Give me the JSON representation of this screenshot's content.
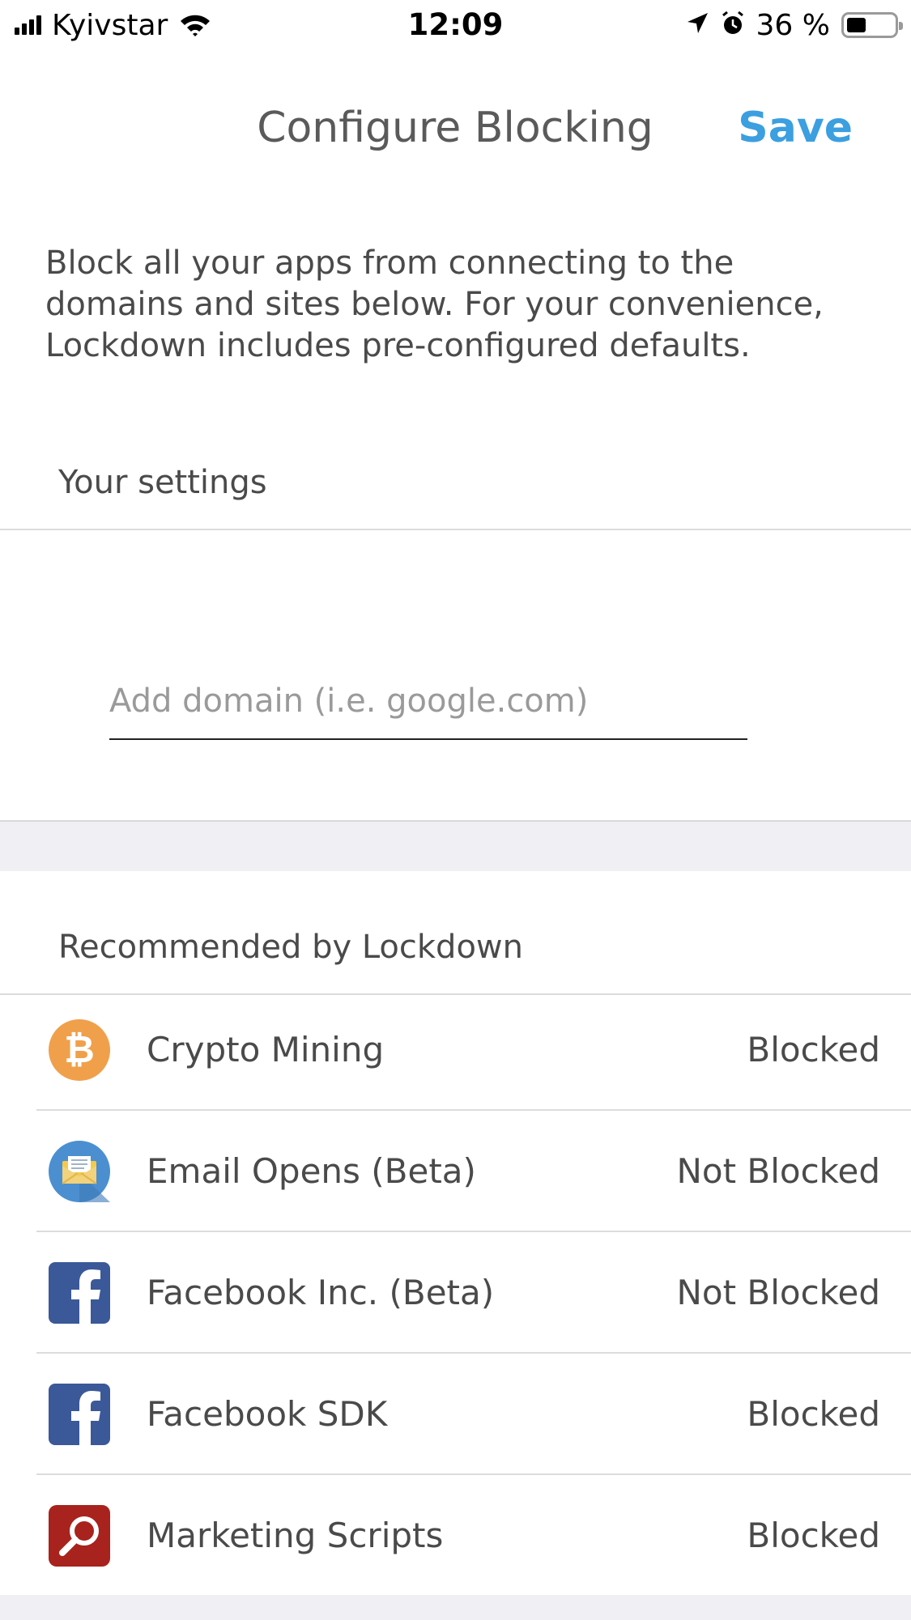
{
  "status_bar": {
    "carrier": "Kyivstar",
    "time": "12:09",
    "battery_percent": "36 %",
    "battery_level": 0.36
  },
  "nav": {
    "title": "Configure Blocking",
    "save_label": "Save",
    "accent_color": "#3b9fe0"
  },
  "description": "Block all your apps from connecting to the domains and sites below. For your convenience, Lockdown includes pre-configured defaults.",
  "your_settings": {
    "header": "Your settings",
    "input_placeholder": "Add domain (i.e. google.com)",
    "input_value": ""
  },
  "recommended": {
    "header": "Recommended by Lockdown",
    "items": [
      {
        "label": "Crypto Mining",
        "status": "Blocked",
        "icon": "bitcoin-icon"
      },
      {
        "label": "Email Opens (Beta)",
        "status": "Not Blocked",
        "icon": "envelope-icon"
      },
      {
        "label": "Facebook Inc. (Beta)",
        "status": "Not Blocked",
        "icon": "facebook-icon"
      },
      {
        "label": "Facebook SDK",
        "status": "Blocked",
        "icon": "facebook-icon"
      },
      {
        "label": "Marketing Scripts",
        "status": "Blocked",
        "icon": "magnifier-icon"
      }
    ]
  }
}
